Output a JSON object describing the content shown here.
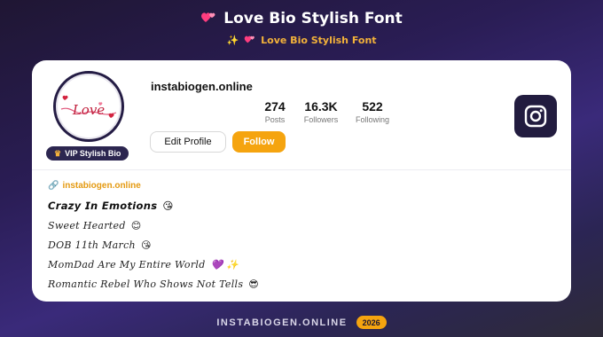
{
  "header": {
    "title": "Love Bio Stylish Font",
    "subtitle": "Love Bio Stylish Font"
  },
  "icons": {
    "title_icon": "two-hearts-icon",
    "subtitle_icons": [
      "sparkles-icon",
      "two-hearts-icon"
    ],
    "badge_icon": "crown-icon",
    "social_icon": "instagram-icon",
    "link_icon": "link-icon",
    "avatar_art": "love-script-logo"
  },
  "profile": {
    "avatar_text": "Love",
    "badge_label": "VIP Stylish Bio",
    "username": "instabiogen.online",
    "stats": [
      {
        "value": "274",
        "label": "Posts"
      },
      {
        "value": "16.3K",
        "label": "Followers"
      },
      {
        "value": "522",
        "label": "Following"
      }
    ],
    "edit_label": "Edit Profile",
    "follow_label": "Follow"
  },
  "bio": {
    "link": "instabiogen.online",
    "lines": [
      {
        "text": "𝘾𝙧𝙖𝙯𝙮 𝙄𝙣 𝙀𝙢𝙤𝙩𝙞𝙤𝙣𝙨",
        "emoji": "😘"
      },
      {
        "text": "Sweet Hearted",
        "emoji": "😊"
      },
      {
        "text": "DOB 11th March",
        "emoji": "😘"
      },
      {
        "text": "MomDad Are My Entire World",
        "emoji": "💜 ✨"
      },
      {
        "text": "Romantic Rebel Who Shows Not Tells",
        "emoji": "😎"
      }
    ]
  },
  "footer": {
    "site": "INSTABIOGEN.ONLINE",
    "year": "2026"
  },
  "colors": {
    "accent": "#f5a40f",
    "dark": "#221c3f",
    "heart": "#ff4f87",
    "link": "#e49a12"
  }
}
